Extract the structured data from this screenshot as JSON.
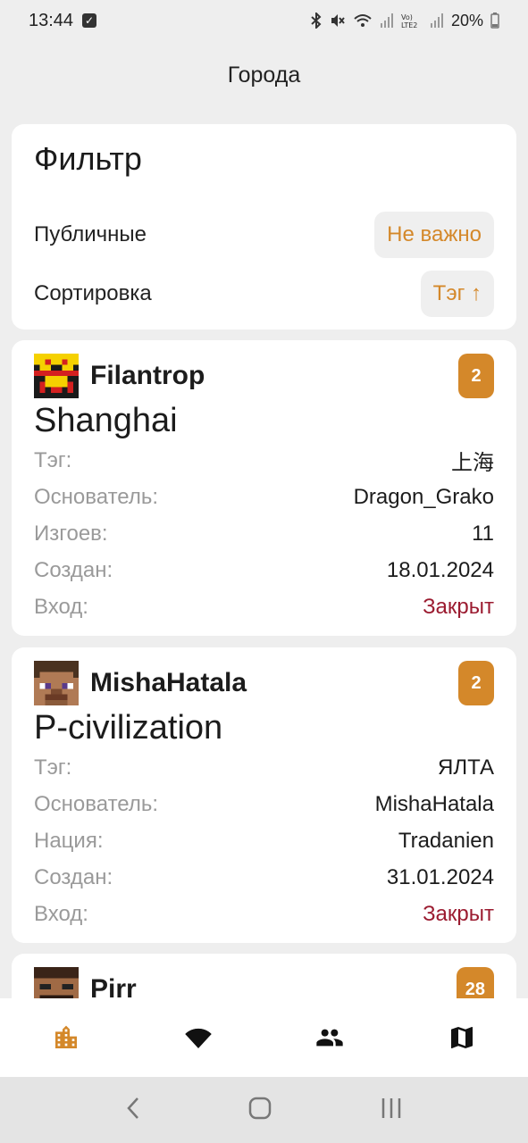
{
  "status": {
    "time": "13:44",
    "battery": "20%"
  },
  "header": {
    "title": "Города"
  },
  "filter": {
    "title": "Фильтр",
    "public_label": "Публичные",
    "public_value": "Не важно",
    "sort_label": "Сортировка",
    "sort_value": "Тэг ↑"
  },
  "cities": [
    {
      "owner": "Filantrop",
      "count": "2",
      "name": "Shanghai",
      "rows": [
        {
          "key": "Тэг:",
          "value": "上海"
        },
        {
          "key": "Основатель:",
          "value": "Dragon_Grako"
        },
        {
          "key": "Изгоев:",
          "value": "11"
        },
        {
          "key": "Создан:",
          "value": "18.01.2024"
        },
        {
          "key": "Вход:",
          "value": "Закрыт"
        }
      ]
    },
    {
      "owner": "MishaHatala",
      "count": "2",
      "name": "P-civilization",
      "rows": [
        {
          "key": "Тэг:",
          "value": "ЯЛТА"
        },
        {
          "key": "Основатель:",
          "value": "MishaHatala"
        },
        {
          "key": "Нация:",
          "value": "Tradanien"
        },
        {
          "key": "Создан:",
          "value": "31.01.2024"
        },
        {
          "key": "Вход:",
          "value": "Закрыт"
        }
      ]
    },
    {
      "owner": "Pirr",
      "count": "28"
    }
  ],
  "colors": {
    "accent": "#d4882a",
    "closed": "#9b1b30",
    "background": "#eeeeee"
  },
  "nav": {
    "items": [
      "city-icon",
      "wifi-icon",
      "people-icon",
      "map-icon"
    ]
  }
}
